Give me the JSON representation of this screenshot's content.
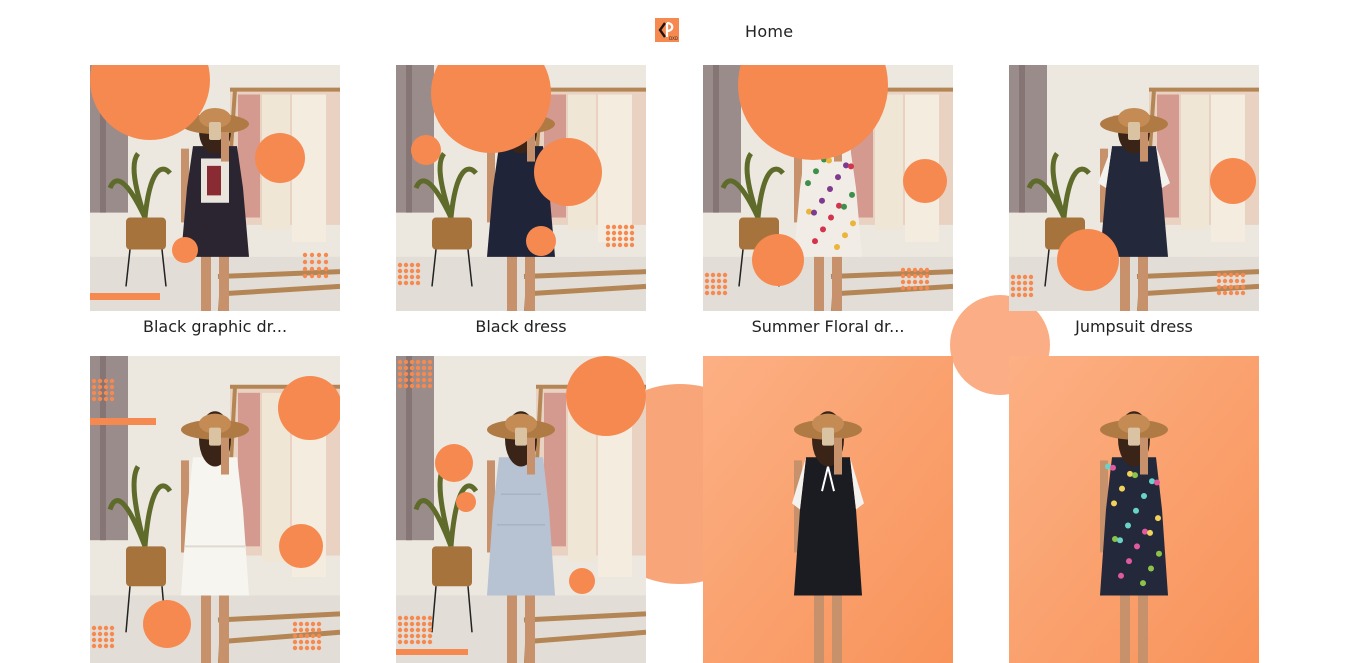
{
  "header": {
    "logo_text": "DXD",
    "nav_home": "Home"
  },
  "colors": {
    "accent": "#f6894f",
    "accent_light": "#fbae85",
    "text": "#222222"
  },
  "products": [
    {
      "name": "Black graphic dr...",
      "scene": "room",
      "dress": "#2a2530",
      "dress_detail": "graphic"
    },
    {
      "name": "Black dress",
      "scene": "room",
      "dress": "#1f2438",
      "dress_detail": "plain"
    },
    {
      "name": "Summer Floral dr...",
      "scene": "room",
      "dress": "#f1ede6",
      "dress_detail": "floral"
    },
    {
      "name": "Jumpsuit dress",
      "scene": "room",
      "dress": "#24283b",
      "dress_detail": "pinafore"
    },
    {
      "name": "",
      "scene": "room",
      "dress": "#f7f5f0",
      "dress_detail": "white"
    },
    {
      "name": "",
      "scene": "room",
      "dress": "#b7c3d2",
      "dress_detail": "lightblue"
    },
    {
      "name": "",
      "scene": "studio",
      "dress": "#1b1b22",
      "dress_detail": "pinafore-bow"
    },
    {
      "name": "",
      "scene": "studio",
      "dress": "#23283a",
      "dress_detail": "floral-dark"
    }
  ]
}
